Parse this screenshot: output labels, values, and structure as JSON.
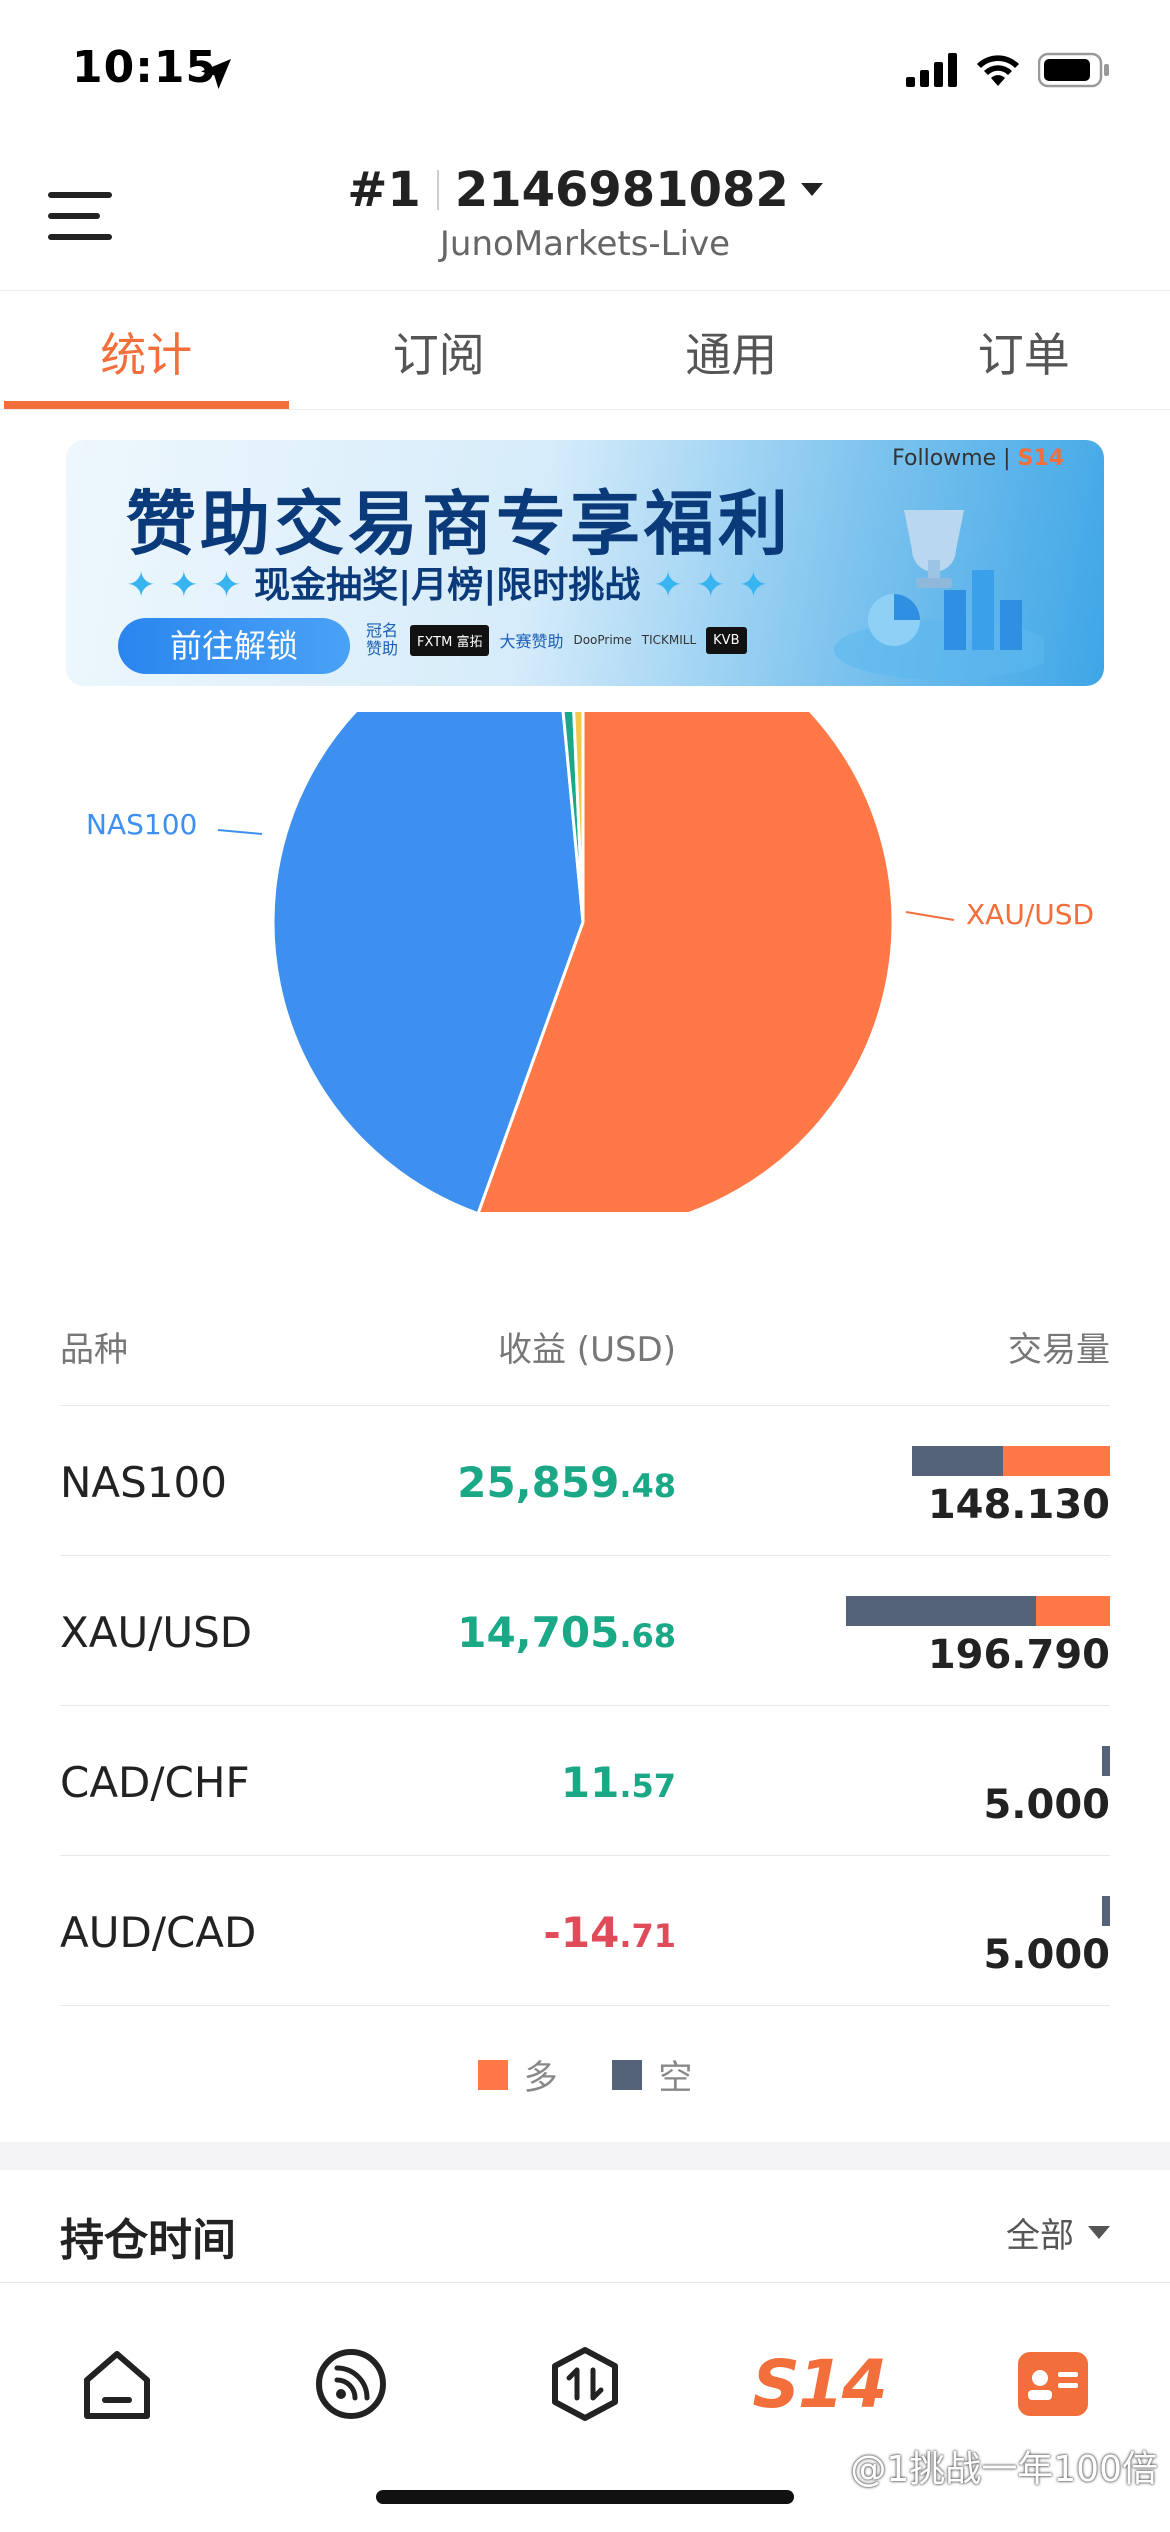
{
  "status": {
    "time": "10:15"
  },
  "header": {
    "rank": "#1",
    "account": "2146981082",
    "server": "JunoMarkets-Live"
  },
  "tabs": [
    {
      "label": "统计",
      "active": true
    },
    {
      "label": "订阅",
      "active": false
    },
    {
      "label": "通用",
      "active": false
    },
    {
      "label": "订单",
      "active": false
    }
  ],
  "banner": {
    "title": "赞助交易商专享福利",
    "subtitle": "现金抽奖|月榜|限时挑战",
    "button": "前往解锁",
    "sponsor_label": "冠名赞助",
    "sponsor_logo": "FXTM 富拓",
    "sponsor_label2": "大赛赞助",
    "sponsors": [
      "DooPrime",
      "TICKMILL",
      "KVB"
    ],
    "brand": "Followme",
    "brand_mark": "S14"
  },
  "chart_data": {
    "type": "pie",
    "slices": [
      {
        "label": "XAU/USD",
        "value": 55.5,
        "color": "#ff7846"
      },
      {
        "label": "NAS100",
        "value": 43.0,
        "color": "#3d8ff0"
      },
      {
        "label": "",
        "value": 0.8,
        "color": "#1aa886"
      },
      {
        "label": "",
        "value": 0.7,
        "color": "#f2c94c"
      }
    ]
  },
  "table": {
    "headers": {
      "symbol": "品种",
      "profit": "收益 (USD)",
      "volume": "交易量"
    },
    "rows": [
      {
        "symbol": "NAS100",
        "profit_int": "25,859",
        "profit_dec": ".48",
        "positive": true,
        "volume": "148.130",
        "bar_total": 0.75,
        "long_frac": 0.54
      },
      {
        "symbol": "XAU/USD",
        "profit_int": "14,705",
        "profit_dec": ".68",
        "positive": true,
        "volume": "196.790",
        "bar_total": 1.0,
        "long_frac": 0.28
      },
      {
        "symbol": "CAD/CHF",
        "profit_int": "11",
        "profit_dec": ".57",
        "positive": true,
        "volume": "5.000",
        "bar_total": 0.03,
        "long_frac": 0.0
      },
      {
        "symbol": "AUD/CAD",
        "profit_int": "-14",
        "profit_dec": ".71",
        "positive": false,
        "volume": "5.000",
        "bar_total": 0.03,
        "long_frac": 0.0
      }
    ]
  },
  "legend": {
    "long": "多",
    "short": "空",
    "long_color": "#ff7846",
    "short_color": "#546378"
  },
  "holding": {
    "title": "持仓时间",
    "filter": "全部"
  },
  "watermark": "@1挑战一年100倍"
}
